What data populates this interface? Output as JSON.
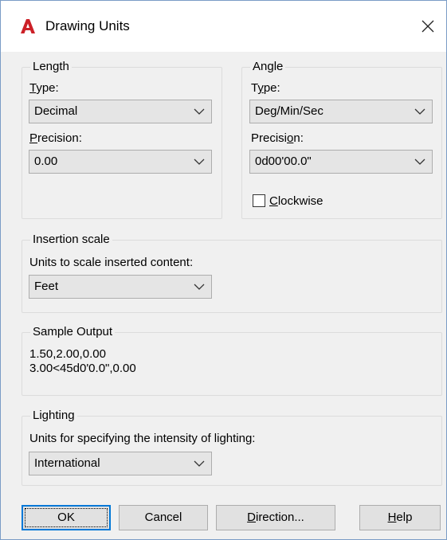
{
  "window": {
    "title": "Drawing Units",
    "close_glyph": "✕",
    "logo_icon": "autocad-logo-icon",
    "accent_color": "#cc2027"
  },
  "length": {
    "legend": "Length",
    "type_label_underline": "T",
    "type_label_rest": "ype:",
    "type_value": "Decimal",
    "precision_label_underline": "P",
    "precision_label_rest": "recision:",
    "precision_value": "0.00"
  },
  "angle": {
    "legend": "Angle",
    "type_label_pre": "T",
    "type_label_underline": "y",
    "type_label_rest": "pe:",
    "type_value": "Deg/Min/Sec",
    "precision_label_pre": "Precisi",
    "precision_label_underline": "o",
    "precision_label_rest": "n:",
    "precision_value": "0d00'00.0\"",
    "clockwise_underline": "C",
    "clockwise_rest": "lockwise",
    "clockwise_checked": false
  },
  "insertion": {
    "legend": "Insertion scale",
    "units_label": "Units to scale inserted content:",
    "units_value": "Feet"
  },
  "sample": {
    "legend": "Sample Output",
    "line1": "1.50,2.00,0.00",
    "line2": "3.00<45d0'0.0\",0.00"
  },
  "lighting": {
    "legend": "Lighting",
    "units_label": "Units for specifying the intensity of lighting:",
    "units_value": "International"
  },
  "buttons": {
    "ok": "OK",
    "cancel": "Cancel",
    "direction_underline": "D",
    "direction_rest": "irection...",
    "help_underline": "H",
    "help_rest": "elp"
  }
}
